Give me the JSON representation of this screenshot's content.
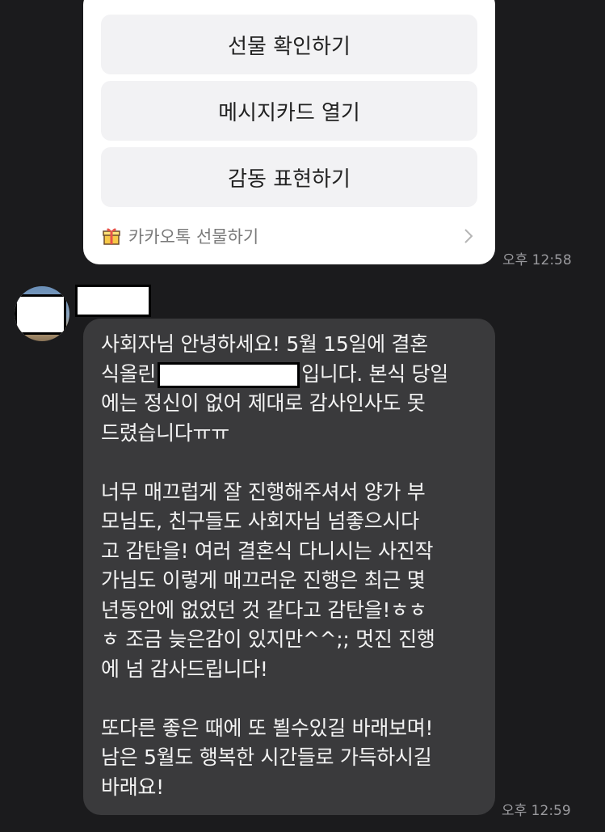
{
  "gift_card": {
    "buttons": [
      "선물 확인하기",
      "메시지카드 열기",
      "감동 표현하기"
    ],
    "footer_label": "카카오톡 선물하기",
    "footer_icon": "gift-box-icon",
    "chevron_icon": "chevron-right-icon"
  },
  "times": {
    "gift": "오후 12:58",
    "message": "오후 12:59"
  },
  "message": {
    "line1": "사회자님 안녕하세요! 5월 15일에 결혼",
    "line2_before": "식올린",
    "line2_after": "입니다. 본식 당일",
    "line3": "에는 정신이 없어 제대로 감사인사도 못",
    "line4": "드렸습니다ㅠㅠ",
    "line5": "너무 매끄럽게 잘 진행해주셔서 양가 부",
    "line6": "모님도, 친구들도 사회자님 넘좋으시다",
    "line7": "고 감탄을! 여러 결혼식 다니시는 사진작",
    "line8": "가님도 이렇게 매끄러운 진행은 최근 몇",
    "line9": "년동안에 없었던 것 같다고 감탄을!ㅎㅎ",
    "line10": "ㅎ 조금 늦은감이 있지만^^;; 멋진 진행",
    "line11": "에 넘 감사드립니다!",
    "line12": "또다른 좋은 때에 또 뵐수있길 바래보며!",
    "line13": "남은 5월도 행복한 시간들로 가득하시길",
    "line14": "바래요!"
  },
  "colors": {
    "background": "#1b1b1d",
    "bubble": "#3a3a3c",
    "card": "#ffffff"
  }
}
